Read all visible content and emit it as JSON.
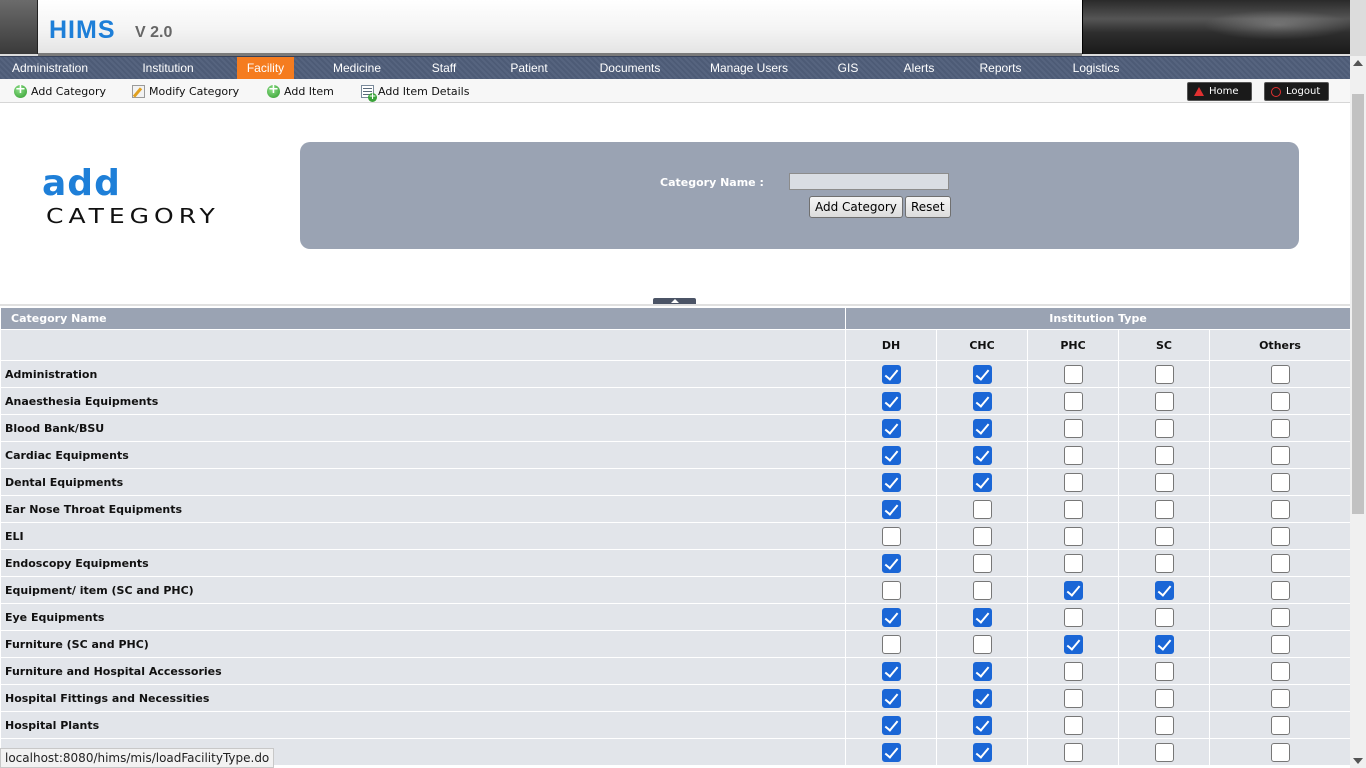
{
  "header": {
    "title": "HIMS",
    "version": "V 2.0"
  },
  "nav": {
    "items": [
      {
        "label": "Administration"
      },
      {
        "label": "Institution"
      },
      {
        "label": "Facility"
      },
      {
        "label": "Medicine"
      },
      {
        "label": "Staff"
      },
      {
        "label": "Patient"
      },
      {
        "label": "Documents"
      },
      {
        "label": "Manage Users"
      },
      {
        "label": "GIS"
      },
      {
        "label": "Alerts"
      },
      {
        "label": "Reports"
      },
      {
        "label": "Logistics"
      }
    ],
    "active": "Facility",
    "active_color": "#f57c1f"
  },
  "subnav": {
    "items": [
      {
        "label": "Add Category",
        "icon": "add-icon"
      },
      {
        "label": "Modify Category",
        "icon": "edit-icon"
      },
      {
        "label": "Add Item",
        "icon": "add-icon"
      },
      {
        "label": "Add Item Details",
        "icon": "details-icon"
      }
    ],
    "home_label": "Home",
    "logout_label": "Logout"
  },
  "brand": {
    "line1": "add",
    "line2": "CATEGORY"
  },
  "form": {
    "label": "Category Name :",
    "value": "",
    "add_button": "Add Category",
    "reset_button": "Reset"
  },
  "table": {
    "header_category": "Category Name",
    "header_institution": "Institution Type",
    "columns": [
      "DH",
      "CHC",
      "PHC",
      "SC",
      "Others"
    ],
    "rows": [
      {
        "name": "Administration",
        "checks": [
          true,
          true,
          false,
          false,
          false
        ]
      },
      {
        "name": "Anaesthesia Equipments",
        "checks": [
          true,
          true,
          false,
          false,
          false
        ]
      },
      {
        "name": "Blood Bank/BSU",
        "checks": [
          true,
          true,
          false,
          false,
          false
        ]
      },
      {
        "name": "Cardiac Equipments",
        "checks": [
          true,
          true,
          false,
          false,
          false
        ]
      },
      {
        "name": "Dental Equipments",
        "checks": [
          true,
          true,
          false,
          false,
          false
        ]
      },
      {
        "name": "Ear Nose Throat Equipments",
        "checks": [
          true,
          false,
          false,
          false,
          false
        ]
      },
      {
        "name": "ELI",
        "checks": [
          false,
          false,
          false,
          false,
          false
        ]
      },
      {
        "name": "Endoscopy Equipments",
        "checks": [
          true,
          false,
          false,
          false,
          false
        ]
      },
      {
        "name": "Equipment/ item (SC and PHC)",
        "checks": [
          false,
          false,
          true,
          true,
          false
        ]
      },
      {
        "name": "Eye Equipments",
        "checks": [
          true,
          true,
          false,
          false,
          false
        ]
      },
      {
        "name": "Furniture (SC and PHC)",
        "checks": [
          false,
          false,
          true,
          true,
          false
        ]
      },
      {
        "name": "Furniture and Hospital Accessories",
        "checks": [
          true,
          true,
          false,
          false,
          false
        ]
      },
      {
        "name": "Hospital Fittings and Necessities",
        "checks": [
          true,
          true,
          false,
          false,
          false
        ]
      },
      {
        "name": "Hospital Plants",
        "checks": [
          true,
          true,
          false,
          false,
          false
        ]
      },
      {
        "name": "",
        "checks": [
          true,
          true,
          false,
          false,
          false
        ]
      }
    ]
  },
  "status_url": "localhost:8080/hims/mis/loadFacilityType.do",
  "colors": {
    "accent": "#1e7fd8",
    "panel": "#9aa3b3",
    "row_bg": "#e2e5ea",
    "checkbox": "#1a66d6"
  }
}
